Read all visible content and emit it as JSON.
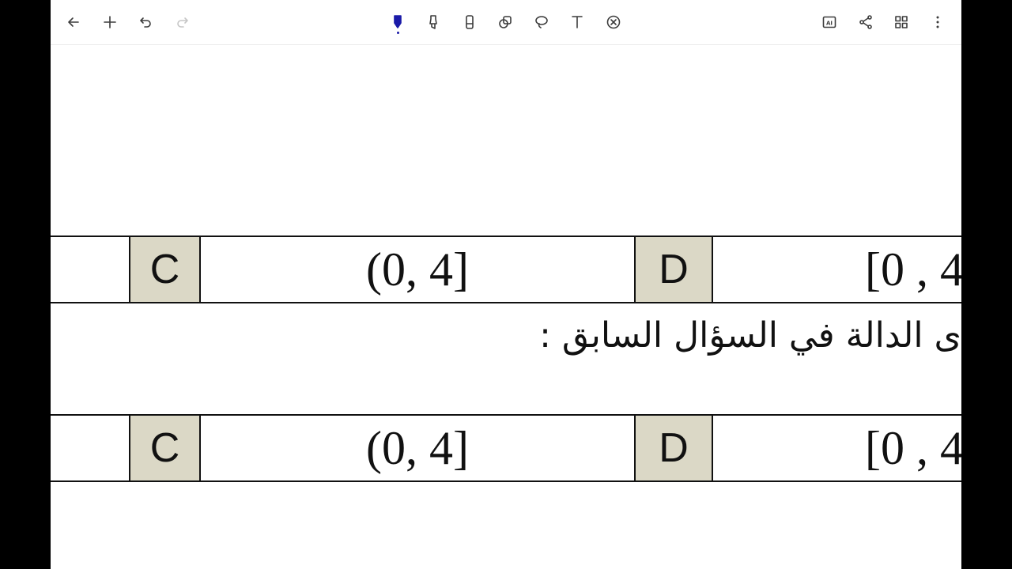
{
  "toolbar": {
    "left_buttons": [
      {
        "name": "back-button",
        "icon": "arrow-left-icon"
      },
      {
        "name": "add-page-button",
        "icon": "plus-icon"
      },
      {
        "name": "undo-button",
        "icon": "undo-icon"
      },
      {
        "name": "redo-button",
        "icon": "redo-icon",
        "disabled": true
      }
    ],
    "center_tools": [
      {
        "name": "pen-tool",
        "icon": "pen-icon",
        "active": true,
        "color": "#1a1aa8"
      },
      {
        "name": "highlighter-tool",
        "icon": "highlighter-icon"
      },
      {
        "name": "eraser-tool",
        "icon": "eraser-icon"
      },
      {
        "name": "shape-tool",
        "icon": "shapes-icon"
      },
      {
        "name": "lasso-tool",
        "icon": "lasso-icon"
      },
      {
        "name": "text-tool",
        "icon": "text-icon",
        "label": "T"
      },
      {
        "name": "remove-tool",
        "icon": "circle-x-icon"
      }
    ],
    "right_buttons": [
      {
        "name": "ai-button",
        "icon": "ai-icon",
        "label": "AI"
      },
      {
        "name": "share-button",
        "icon": "share-icon"
      },
      {
        "name": "grid-view-button",
        "icon": "grid-icon"
      },
      {
        "name": "more-button",
        "icon": "more-vertical-icon"
      }
    ]
  },
  "document": {
    "rows": [
      {
        "c_label": "C",
        "c_value": "(0, 4]",
        "d_label": "D",
        "d_value": "[0 , 4"
      },
      {
        "c_label": "C",
        "c_value": "(0, 4]",
        "d_label": "D",
        "d_value": "[0 , 4"
      }
    ],
    "question_text": "ى الدالة في السؤال السابق :"
  },
  "colors": {
    "letter_cell_bg": "#dbd8c6",
    "ink": "#111111",
    "page": "#ffffff",
    "frame": "#000000"
  }
}
